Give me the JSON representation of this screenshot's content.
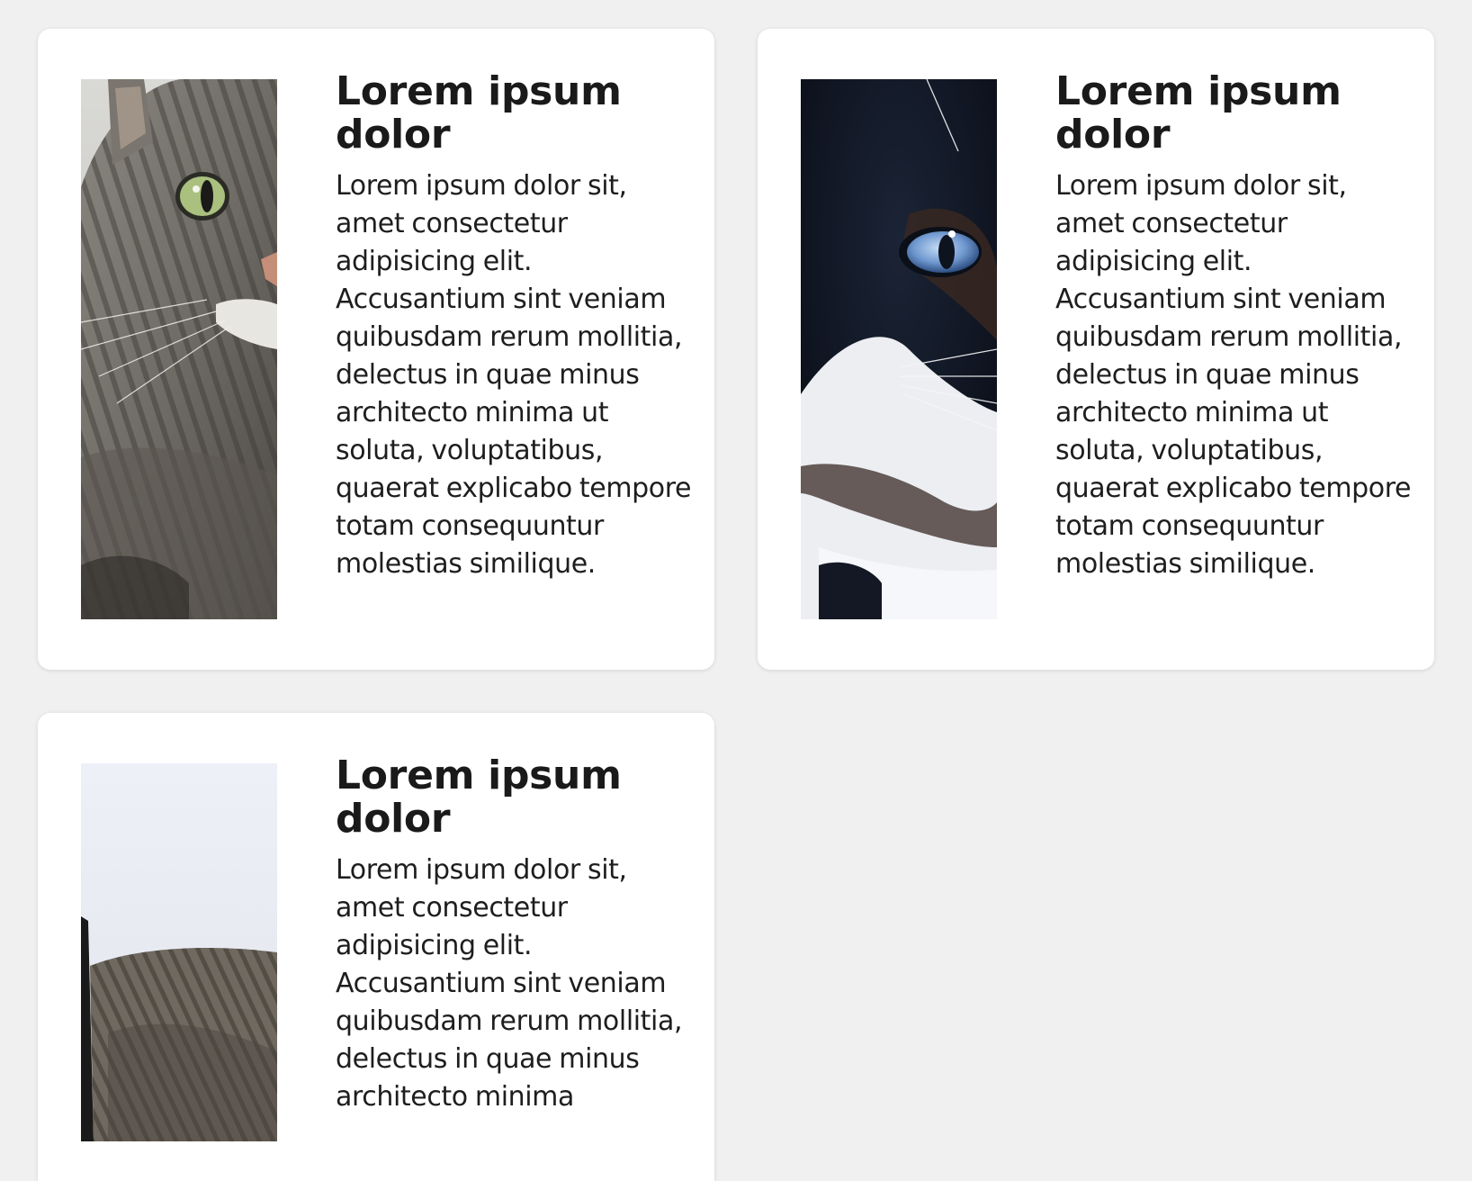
{
  "cards": [
    {
      "title": "Lorem ipsum dolor",
      "body": "Lorem ipsum dolor sit, amet consectetur adipisicing elit. Accusantium sint veniam quibusdam rerum mollitia, delectus in quae minus architecto minima ut soluta, voluptatibus, quaerat explicabo tempore totam consequuntur molestias similique.",
      "image": "tabby-cat-half-face-photo"
    },
    {
      "title": "Lorem ipsum dolor",
      "body": "Lorem ipsum dolor sit, amet consectetur adipisicing elit. Accusantium sint veniam quibusdam rerum mollitia, delectus in quae minus architecto minima ut soluta, voluptatibus, quaerat explicabo tempore totam consequuntur molestias similique.",
      "image": "black-white-cat-blue-eye-photo"
    },
    {
      "title": "Lorem ipsum dolor",
      "body": "Lorem ipsum dolor sit, amet consectetur adipisicing elit. Accusantium sint veniam quibusdam rerum mollitia, delectus in quae minus architecto minima",
      "image": "sleeping-tabby-cat-photo"
    }
  ]
}
